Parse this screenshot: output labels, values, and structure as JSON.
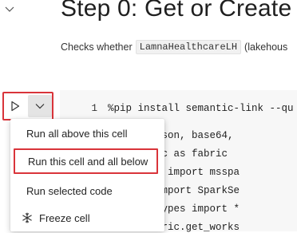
{
  "cell": {
    "title": "Step 0: Get or Create",
    "description_prefix": "Checks whether",
    "description_chip": "LamnaHealthcareLH",
    "description_suffix": "(lakehous"
  },
  "toolbar": {
    "run_icon": "play-icon",
    "dropdown_icon": "chevron-down-icon"
  },
  "editor": {
    "line_number": "1",
    "lines": [
      "%pip install semantic-link --qu",
      "quests, json, base64,",
      "mpy.fabric as fabric",
      "bookutils import msspa",
      "ark.sql import SparkSe",
      "ark.sql.types import *",
      "_id = fabric.get_works"
    ]
  },
  "menu": {
    "items": [
      {
        "label": "Run all above this cell"
      },
      {
        "label": "Run this cell and all below",
        "highlighted": true
      },
      {
        "label": "Run selected code"
      },
      {
        "label": "Freeze cell",
        "icon": "snowflake-icon"
      }
    ]
  },
  "colors": {
    "highlight_border": "#d9343a",
    "dropdown_bg": "#e4e4e4",
    "code_bg": "#f7f7f7"
  }
}
